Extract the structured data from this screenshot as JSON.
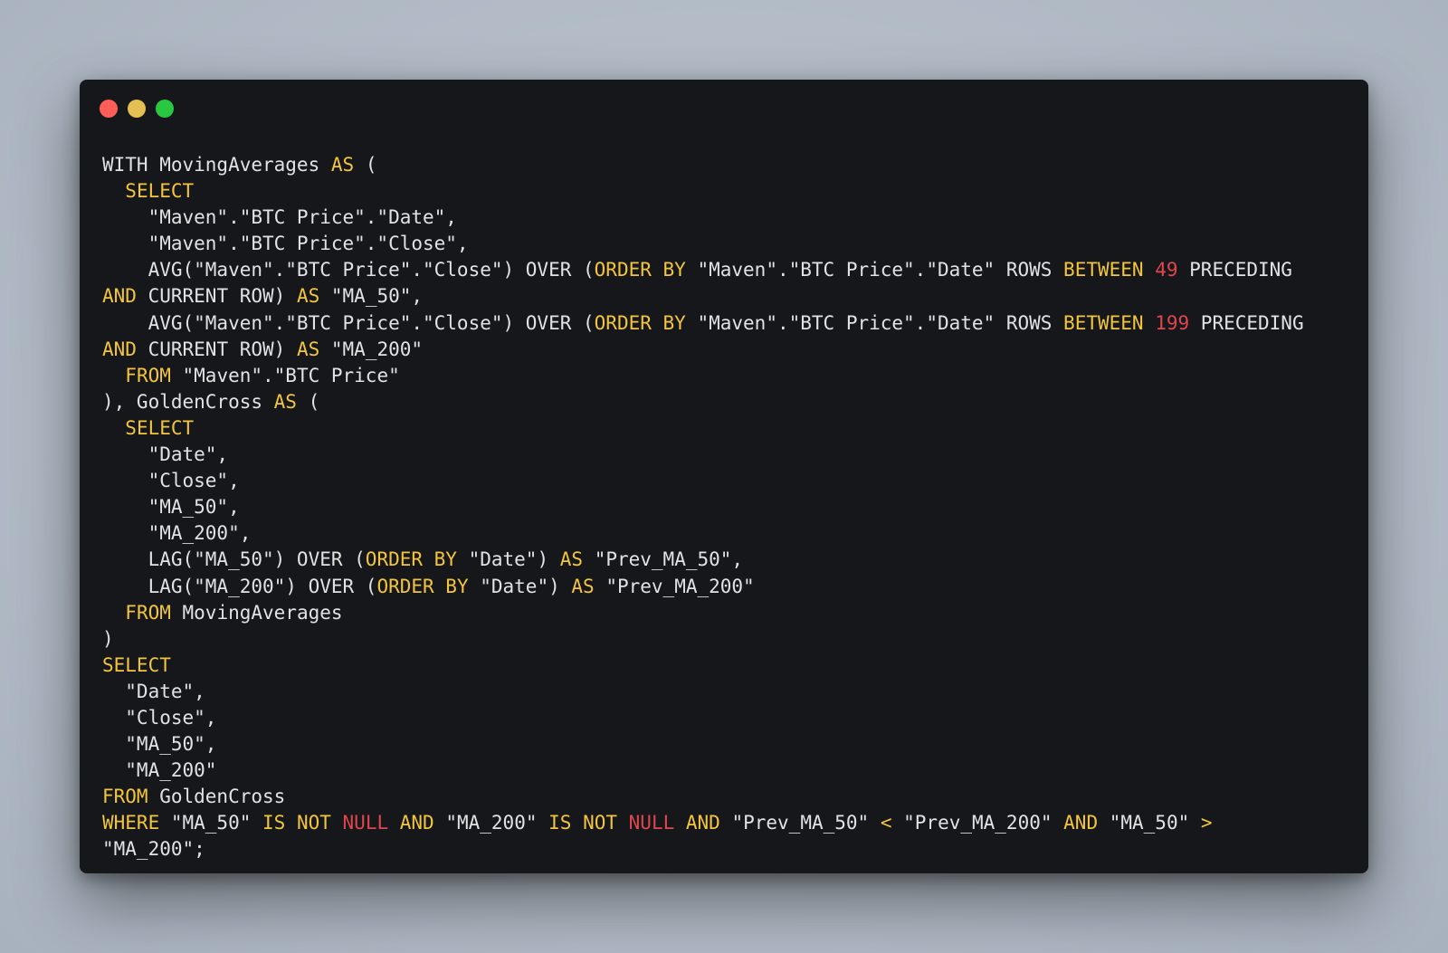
{
  "window": {
    "controls": {
      "close_color": "#ff5f57",
      "minimize_color": "#e5bf52",
      "maximize_color": "#28c840"
    },
    "background_color": "#15171b"
  },
  "colors": {
    "keyword": "#f3c53f",
    "null_keyword": "#e0464c",
    "number": "#e0464c",
    "text": "#e2e2e2"
  },
  "code": {
    "language": "sql",
    "lines": [
      [
        [
          "plain",
          "WITH MovingAverages "
        ],
        [
          "kw",
          "AS"
        ],
        [
          "plain",
          " ("
        ]
      ],
      [
        [
          "plain",
          "  "
        ],
        [
          "kw",
          "SELECT"
        ]
      ],
      [
        [
          "plain",
          "    \"Maven\".\"BTC Price\".\"Date\","
        ]
      ],
      [
        [
          "plain",
          "    \"Maven\".\"BTC Price\".\"Close\","
        ]
      ],
      [
        [
          "plain",
          "    AVG(\"Maven\".\"BTC Price\".\"Close\") OVER ("
        ],
        [
          "kw",
          "ORDER BY"
        ],
        [
          "plain",
          " \"Maven\".\"BTC Price\".\"Date\" ROWS "
        ],
        [
          "kw",
          "BETWEEN"
        ],
        [
          "plain",
          " "
        ],
        [
          "num",
          "49"
        ],
        [
          "plain",
          " PRECEDING"
        ]
      ],
      [
        [
          "kw",
          "AND"
        ],
        [
          "plain",
          " CURRENT ROW) "
        ],
        [
          "kw",
          "AS"
        ],
        [
          "plain",
          " \"MA_50\","
        ]
      ],
      [
        [
          "plain",
          "    AVG(\"Maven\".\"BTC Price\".\"Close\") OVER ("
        ],
        [
          "kw",
          "ORDER BY"
        ],
        [
          "plain",
          " \"Maven\".\"BTC Price\".\"Date\" ROWS "
        ],
        [
          "kw",
          "BETWEEN"
        ],
        [
          "plain",
          " "
        ],
        [
          "num",
          "199"
        ],
        [
          "plain",
          " PRECEDING"
        ]
      ],
      [
        [
          "kw",
          "AND"
        ],
        [
          "plain",
          " CURRENT ROW) "
        ],
        [
          "kw",
          "AS"
        ],
        [
          "plain",
          " \"MA_200\""
        ]
      ],
      [
        [
          "plain",
          "  "
        ],
        [
          "kw",
          "FROM"
        ],
        [
          "plain",
          " \"Maven\".\"BTC Price\""
        ]
      ],
      [
        [
          "plain",
          "), GoldenCross "
        ],
        [
          "kw",
          "AS"
        ],
        [
          "plain",
          " ("
        ]
      ],
      [
        [
          "plain",
          "  "
        ],
        [
          "kw",
          "SELECT"
        ]
      ],
      [
        [
          "plain",
          "    \"Date\","
        ]
      ],
      [
        [
          "plain",
          "    \"Close\","
        ]
      ],
      [
        [
          "plain",
          "    \"MA_50\","
        ]
      ],
      [
        [
          "plain",
          "    \"MA_200\","
        ]
      ],
      [
        [
          "plain",
          "    LAG(\"MA_50\") OVER ("
        ],
        [
          "kw",
          "ORDER BY"
        ],
        [
          "plain",
          " \"Date\") "
        ],
        [
          "kw",
          "AS"
        ],
        [
          "plain",
          " \"Prev_MA_50\","
        ]
      ],
      [
        [
          "plain",
          "    LAG(\"MA_200\") OVER ("
        ],
        [
          "kw",
          "ORDER BY"
        ],
        [
          "plain",
          " \"Date\") "
        ],
        [
          "kw",
          "AS"
        ],
        [
          "plain",
          " \"Prev_MA_200\""
        ]
      ],
      [
        [
          "plain",
          "  "
        ],
        [
          "kw",
          "FROM"
        ],
        [
          "plain",
          " MovingAverages"
        ]
      ],
      [
        [
          "plain",
          ")"
        ]
      ],
      [
        [
          "kw",
          "SELECT"
        ]
      ],
      [
        [
          "plain",
          "  \"Date\","
        ]
      ],
      [
        [
          "plain",
          "  \"Close\","
        ]
      ],
      [
        [
          "plain",
          "  \"MA_50\","
        ]
      ],
      [
        [
          "plain",
          "  \"MA_200\""
        ]
      ],
      [
        [
          "kw",
          "FROM"
        ],
        [
          "plain",
          " GoldenCross"
        ]
      ],
      [
        [
          "kw",
          "WHERE"
        ],
        [
          "plain",
          " \"MA_50\" "
        ],
        [
          "kw",
          "IS NOT"
        ],
        [
          "plain",
          " "
        ],
        [
          "red",
          "NULL"
        ],
        [
          "plain",
          " "
        ],
        [
          "kw",
          "AND"
        ],
        [
          "plain",
          " \"MA_200\" "
        ],
        [
          "kw",
          "IS NOT"
        ],
        [
          "plain",
          " "
        ],
        [
          "red",
          "NULL"
        ],
        [
          "plain",
          " "
        ],
        [
          "kw",
          "AND"
        ],
        [
          "plain",
          " \"Prev_MA_50\" "
        ],
        [
          "op",
          "<"
        ],
        [
          "plain",
          " \"Prev_MA_200\" "
        ],
        [
          "kw",
          "AND"
        ],
        [
          "plain",
          " \"MA_50\" "
        ],
        [
          "op",
          ">"
        ]
      ],
      [
        [
          "plain",
          "\"MA_200\";"
        ]
      ]
    ]
  }
}
